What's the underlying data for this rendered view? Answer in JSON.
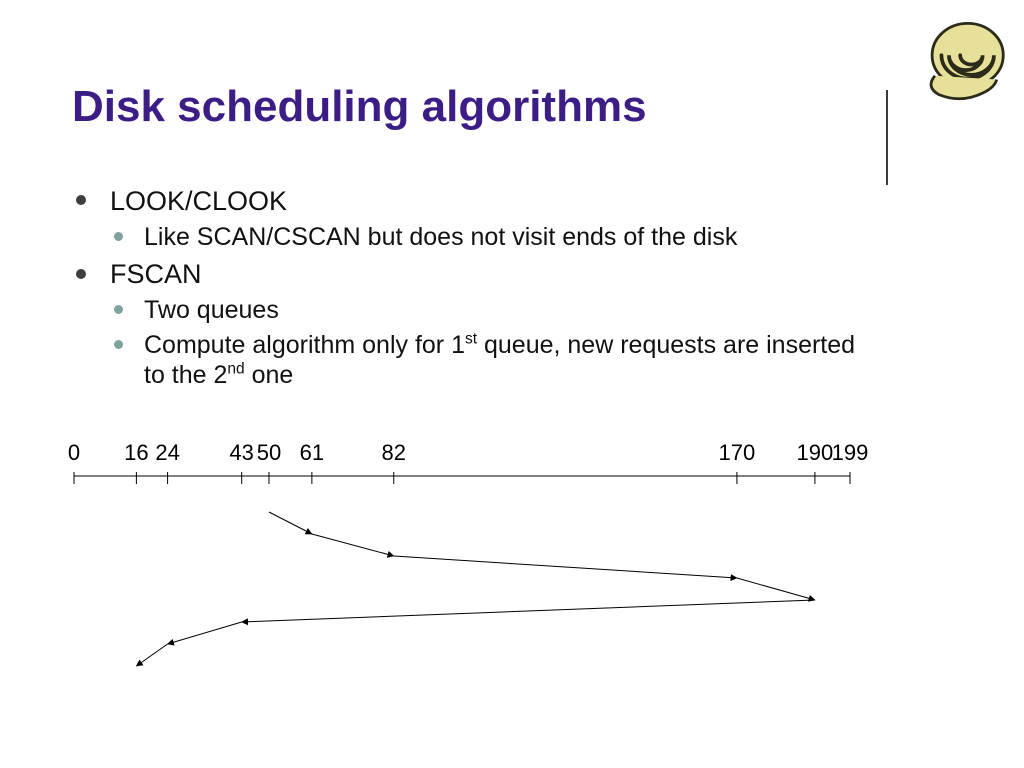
{
  "title": "Disk scheduling algorithms",
  "bullets": {
    "b1": "LOOK/CLOOK",
    "b1_1": "Like SCAN/CSCAN but does not visit ends of the disk",
    "b2": "FSCAN",
    "b2_1": "Two queues",
    "b2_2_pre": "Compute algorithm only for 1",
    "b2_2_sup1": "st",
    "b2_2_mid": " queue, new requests are inserted to the 2",
    "b2_2_sup2": "nd",
    "b2_2_post": " one"
  },
  "chart_data": {
    "type": "line",
    "ticks": [
      0,
      16,
      24,
      43,
      50,
      61,
      82,
      170,
      190,
      199
    ],
    "xlim": [
      0,
      199
    ],
    "seek_sequence": [
      50,
      61,
      82,
      170,
      190,
      43,
      24,
      16
    ],
    "title": "",
    "xlabel": "",
    "ylabel": ""
  }
}
